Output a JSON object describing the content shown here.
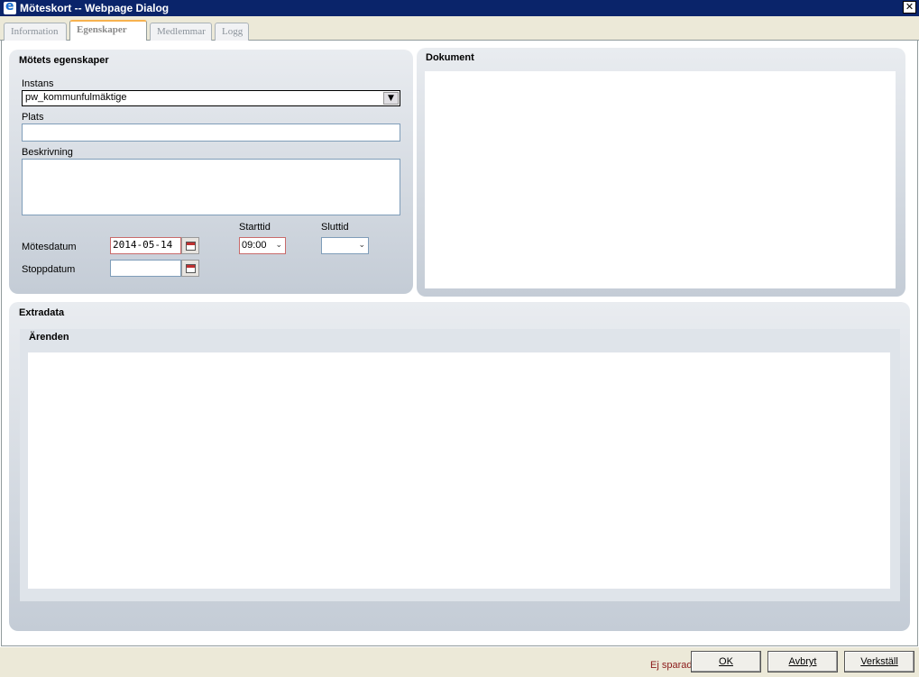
{
  "window": {
    "title": "Möteskort -- Webpage Dialog",
    "close_symbol": "✕"
  },
  "tabs": [
    {
      "label": "Information",
      "active": false
    },
    {
      "label": "Egenskaper",
      "active": true
    },
    {
      "label": "Medlemmar",
      "active": false
    },
    {
      "label": "Logg",
      "active": false
    }
  ],
  "properties": {
    "title": "Mötets egenskaper",
    "instance_label": "Instans",
    "instance_value": "pw_kommunfulmäktige",
    "place_label": "Plats",
    "place_value": "",
    "description_label": "Beskrivning",
    "description_value": "",
    "start_time_label": "Starttid",
    "end_time_label": "Sluttid",
    "meeting_date_label": "Mötesdatum",
    "meeting_date_value": "2014-05-14",
    "start_time_value": "09:00",
    "end_time_value": "",
    "stop_date_label": "Stoppdatum",
    "stop_date_value": ""
  },
  "documents": {
    "title": "Dokument"
  },
  "extradata": {
    "title": "Extradata",
    "cases_title": "Ärenden"
  },
  "footer": {
    "status": "Ej sparad",
    "ok_label": "OK",
    "cancel_label": "Avbryt",
    "apply_label": "Verkställ"
  },
  "icons": {
    "window": "ie-icon",
    "calendar": "calendar-icon",
    "dropdown": "chevron-down-icon"
  }
}
